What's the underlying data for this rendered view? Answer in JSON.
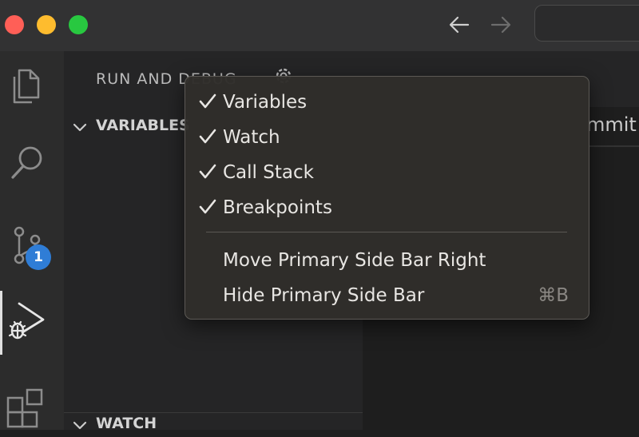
{
  "window": {
    "controls": [
      "close",
      "minimize",
      "zoom"
    ],
    "nav": {
      "back_icon": "arrow-left-icon",
      "forward_icon": "arrow-right-icon"
    }
  },
  "activity_bar": {
    "items": [
      {
        "id": "explorer",
        "icon": "files-icon"
      },
      {
        "id": "search",
        "icon": "search-icon"
      },
      {
        "id": "source-control",
        "icon": "source-control-icon",
        "badge": "1"
      },
      {
        "id": "run-debug",
        "icon": "run-debug-icon",
        "active": true
      },
      {
        "id": "extensions",
        "icon": "extensions-icon"
      }
    ]
  },
  "sidebar": {
    "title": "RUN AND DEBUG",
    "sections": [
      {
        "label": "VARIABLES",
        "expanded": true
      },
      {
        "label": "WATCH",
        "expanded": true
      }
    ]
  },
  "editor": {
    "partial_text": "mmit"
  },
  "context_menu": {
    "items": [
      {
        "label": "Variables",
        "checked": true
      },
      {
        "label": "Watch",
        "checked": true
      },
      {
        "label": "Call Stack",
        "checked": true
      },
      {
        "label": "Breakpoints",
        "checked": true
      },
      {
        "label": "Move Primary Side Bar Right",
        "checked": false
      },
      {
        "label": "Hide Primary Side Bar",
        "checked": false,
        "shortcut": "⌘B"
      }
    ]
  },
  "colors": {
    "accent_badge": "#2f7dd6",
    "close": "#ff5f57",
    "minimize": "#febc2e",
    "zoom": "#28c840"
  }
}
